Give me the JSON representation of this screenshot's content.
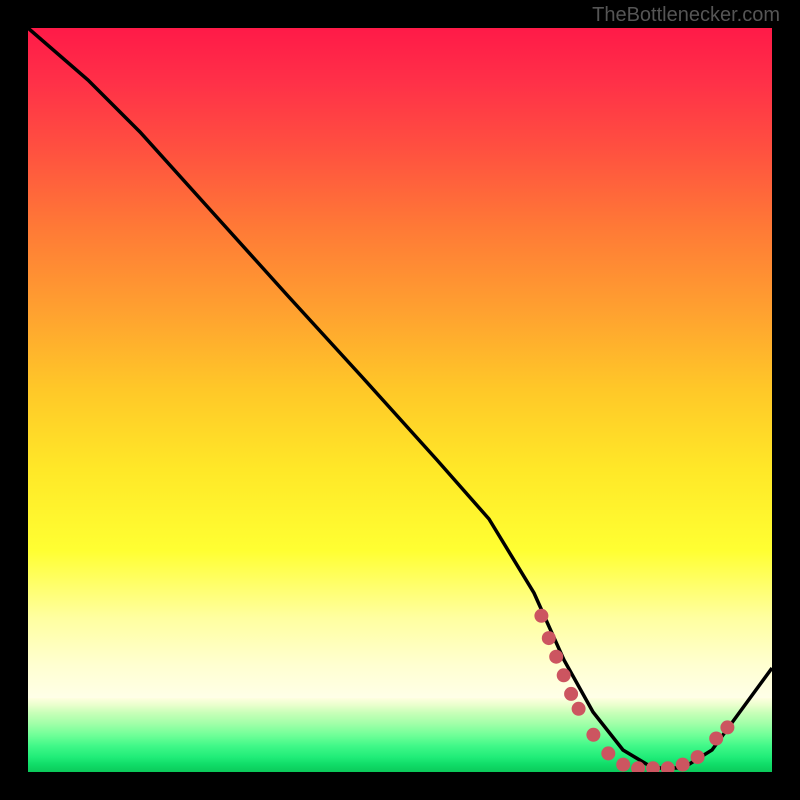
{
  "watermark": "TheBottlenecker.com",
  "chart_data": {
    "type": "line",
    "title": "",
    "xlabel": "",
    "ylabel": "",
    "xlim": [
      0,
      100
    ],
    "ylim": [
      0,
      100
    ],
    "series": [
      {
        "name": "curve",
        "x": [
          0,
          8,
          15,
          25,
          35,
          45,
          55,
          62,
          68,
          72,
          76,
          80,
          84,
          88,
          92,
          100
        ],
        "y": [
          100,
          93,
          86,
          75,
          64,
          53,
          42,
          34,
          24,
          15,
          8,
          3,
          0.5,
          0.5,
          3,
          14
        ]
      }
    ],
    "markers": [
      {
        "x": 69,
        "y": 21
      },
      {
        "x": 70,
        "y": 18
      },
      {
        "x": 71,
        "y": 15.5
      },
      {
        "x": 72,
        "y": 13
      },
      {
        "x": 73,
        "y": 10.5
      },
      {
        "x": 74,
        "y": 8.5
      },
      {
        "x": 76,
        "y": 5
      },
      {
        "x": 78,
        "y": 2.5
      },
      {
        "x": 80,
        "y": 1
      },
      {
        "x": 82,
        "y": 0.5
      },
      {
        "x": 84,
        "y": 0.5
      },
      {
        "x": 86,
        "y": 0.5
      },
      {
        "x": 88,
        "y": 1
      },
      {
        "x": 90,
        "y": 2
      },
      {
        "x": 92.5,
        "y": 4.5
      },
      {
        "x": 94,
        "y": 6
      }
    ]
  }
}
